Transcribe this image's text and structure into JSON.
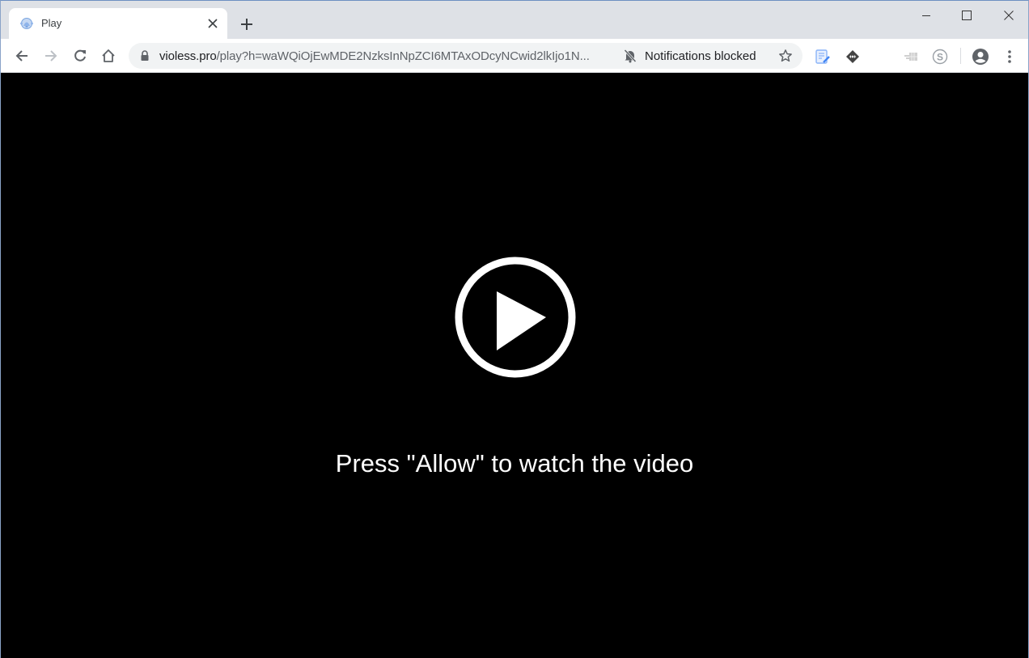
{
  "browser": {
    "tab": {
      "title": "Play",
      "favicon": "bell-favicon-icon",
      "close_icon": "close-icon"
    },
    "new_tab_icon": "plus-icon",
    "window_controls": [
      "minimize-icon",
      "maximize-icon",
      "close-icon"
    ],
    "nav": {
      "back_icon": "arrow-left-icon",
      "forward_icon": "arrow-right-icon",
      "reload_icon": "reload-icon",
      "home_icon": "home-icon"
    },
    "address_bar": {
      "host": "violess.pro",
      "path": "/play?h=waWQiOjEwMDE2NzksInNpZCI6MTAxODcyNCwid2lkIjo1N...",
      "secure_icon": "lock-icon"
    },
    "notifications_chip": {
      "icon": "bell-slash-icon",
      "label": "Notifications blocked"
    },
    "bookmark_icon": "star-icon",
    "extensions": [
      "notes-edit-icon",
      "diamond-arrows-icon",
      "grid-extension-icon",
      "s-circle-icon"
    ],
    "profile_icon": "account-circle-icon",
    "menu_icon": "kebab-menu-icon"
  },
  "page": {
    "play_button_icon": "play-circle-icon",
    "message": "Press \"Allow\" to watch the video"
  },
  "colors": {
    "tabstrip_bg": "#dee1e6",
    "page_bg": "#000000",
    "text_white": "#ffffff"
  }
}
